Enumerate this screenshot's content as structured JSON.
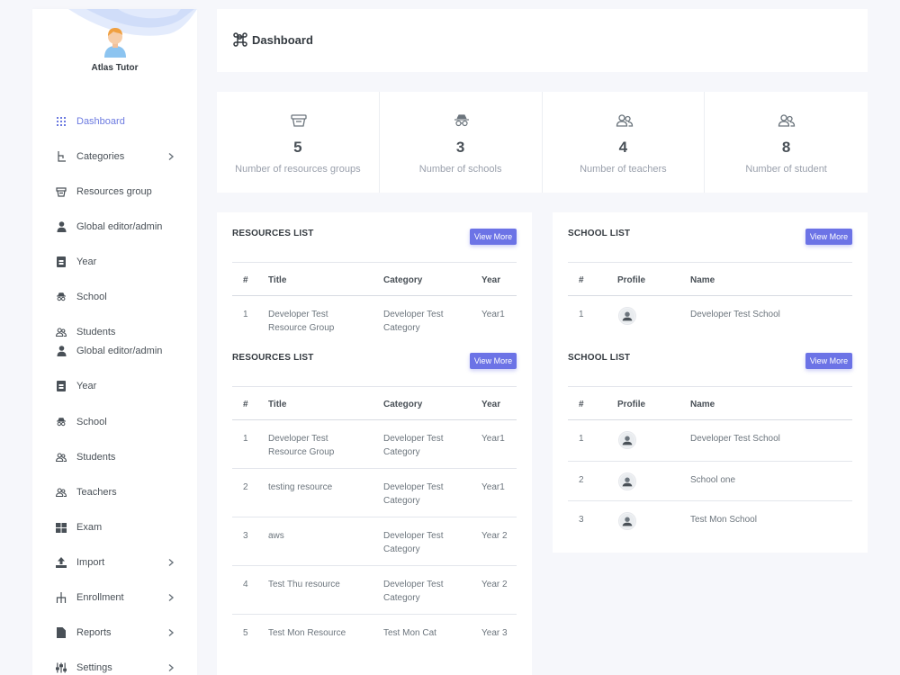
{
  "brand": {
    "name": "Atlas Tutor"
  },
  "sidebar": {
    "items": [
      {
        "label": "Dashboard",
        "icon": "grid-icon",
        "active": true
      },
      {
        "label": "Categories",
        "icon": "hierarchy-icon",
        "chevron": true
      },
      {
        "label": "Resources group",
        "icon": "basket-icon"
      },
      {
        "label": "Global editor/admin",
        "icon": "user-icon"
      },
      {
        "label": "Year",
        "icon": "calendar-icon"
      },
      {
        "label": "School",
        "icon": "spy-icon"
      },
      {
        "label": "Students",
        "icon": "users-icon"
      },
      {
        "label": "Global editor/admin",
        "icon": "user-icon"
      },
      {
        "label": "Year",
        "icon": "calendar-icon"
      },
      {
        "label": "School",
        "icon": "spy-icon"
      },
      {
        "label": "Students",
        "icon": "users-icon"
      },
      {
        "label": "Teachers",
        "icon": "users-icon"
      },
      {
        "label": "Exam",
        "icon": "windows-icon"
      },
      {
        "label": "Import",
        "icon": "upload-icon",
        "chevron": true
      },
      {
        "label": "Enrollment",
        "icon": "sitemap-icon",
        "chevron": true
      },
      {
        "label": "Reports",
        "icon": "file-icon",
        "chevron": true
      },
      {
        "label": "Settings",
        "icon": "sliders-icon",
        "chevron": true
      }
    ]
  },
  "header": {
    "title": "Dashboard",
    "icon": "command-icon"
  },
  "stats": [
    {
      "value": "5",
      "label": "Number of resources groups",
      "icon": "basket-icon"
    },
    {
      "value": "3",
      "label": "Number of schools",
      "icon": "spy-icon"
    },
    {
      "value": "4",
      "label": "Number of teachers",
      "icon": "users-icon"
    },
    {
      "value": "8",
      "label": "Number of student",
      "icon": "users-icon"
    }
  ],
  "resources1": {
    "title": "RESOURCES LIST",
    "button": "View More",
    "columns": [
      "#",
      "Title",
      "Category",
      "Year"
    ],
    "rows": [
      [
        "1",
        "Developer Test Resource Group",
        "Developer Test Category",
        "Year1"
      ]
    ]
  },
  "resources2": {
    "title": "RESOURCES LIST",
    "button": "View More",
    "columns": [
      "#",
      "Title",
      "Category",
      "Year"
    ],
    "rows": [
      [
        "1",
        "Developer Test Resource Group",
        "Developer Test Category",
        "Year1"
      ],
      [
        "2",
        "testing resource",
        "Developer Test Category",
        "Year1"
      ],
      [
        "3",
        "aws",
        "Developer Test Category",
        "Year 2"
      ],
      [
        "4",
        "Test Thu resource",
        "Developer Test Category",
        "Year 2"
      ],
      [
        "5",
        "Test Mon Resource",
        "Test Mon Cat",
        "Year 3"
      ]
    ]
  },
  "schools1": {
    "title": "SCHOOL LIST",
    "button": "View More",
    "columns": [
      "#",
      "Profile",
      "Name"
    ],
    "rows": [
      [
        "1",
        "Developer Test School"
      ]
    ]
  },
  "schools2": {
    "title": "SCHOOL LIST",
    "button": "View More",
    "columns": [
      "#",
      "Profile",
      "Name"
    ],
    "rows": [
      [
        "1",
        "Developer Test School"
      ],
      [
        "2",
        "School one"
      ],
      [
        "3",
        "Test Mon School"
      ]
    ]
  },
  "colors": {
    "accent": "#6c7ae0",
    "button": "#6c73e6",
    "background": "#f6f7fb"
  }
}
